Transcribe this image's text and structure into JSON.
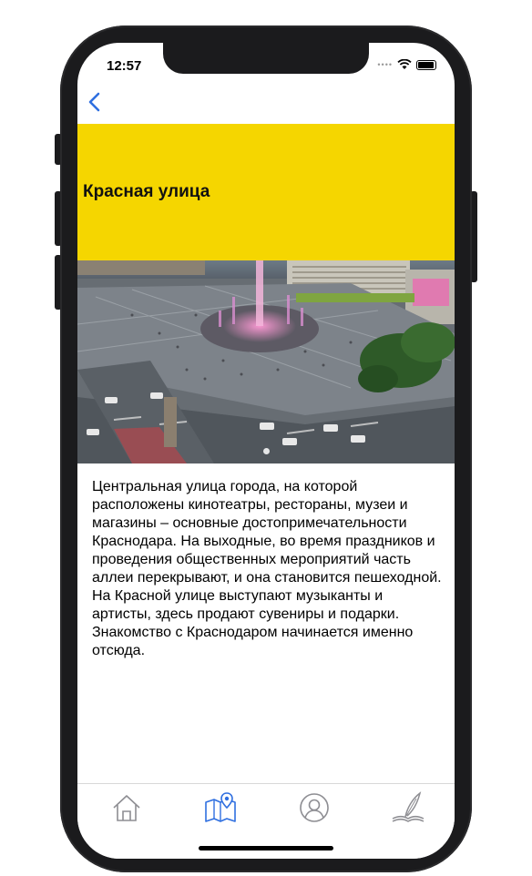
{
  "status": {
    "time": "12:57"
  },
  "nav": {
    "back": "back"
  },
  "header": {
    "title": "Красная улица",
    "color": "#f5d600"
  },
  "photo": {
    "alt": "Красная улица",
    "page_count": 1,
    "current_page": 1
  },
  "description": "Центральная улица города, на которой расположены кинотеатры, рестораны, музеи и магазины – основные достопримечательности Краснодара. На выходные, во время праздников и проведения общественных мероприятий часть аллеи перекрывают, и она становится пешеходной. На Красной улице выступают музыканты и артисты, здесь продают сувениры и подарки. Знакомство с Краснодаром начинается именно отсюда.",
  "tabs": [
    {
      "icon": "home-icon",
      "active": false
    },
    {
      "icon": "map-pin-icon",
      "active": true
    },
    {
      "icon": "profile-icon",
      "active": false
    },
    {
      "icon": "quill-book-icon",
      "active": false
    }
  ],
  "colors": {
    "accent": "#2f6fe0",
    "tab_inactive": "#8e8e93"
  }
}
